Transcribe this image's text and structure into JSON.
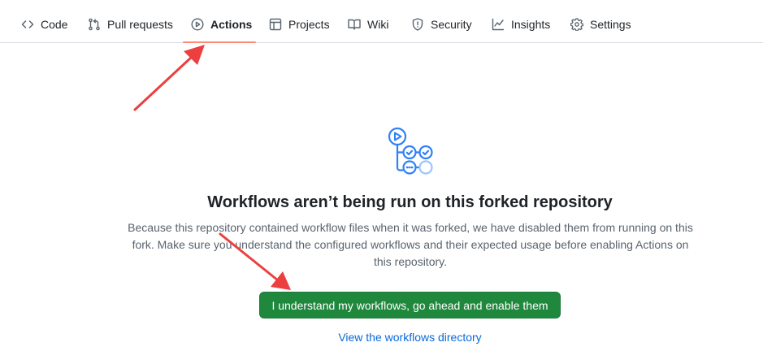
{
  "nav": {
    "items": [
      {
        "label": "Code",
        "icon": "code-icon"
      },
      {
        "label": "Pull requests",
        "icon": "git-pull-request-icon"
      },
      {
        "label": "Actions",
        "icon": "play-icon",
        "selected": true
      },
      {
        "label": "Projects",
        "icon": "table-icon"
      },
      {
        "label": "Wiki",
        "icon": "book-icon"
      },
      {
        "label": "Security",
        "icon": "shield-icon"
      },
      {
        "label": "Insights",
        "icon": "graph-icon"
      },
      {
        "label": "Settings",
        "icon": "gear-icon"
      }
    ],
    "selected_underline_color": "#fd8c73"
  },
  "blankslate": {
    "illustration": "workflow-graph-icon",
    "title": "Workflows aren’t being run on this forked repository",
    "description": "Because this repository contained workflow files when it was forked, we have disabled them from running on this fork. Make sure you understand the configured workflows and their expected usage before enabling Actions on this repository.",
    "enable_button_label": "I understand my workflows, go ahead and enable them",
    "directory_link_label": "View the workflows directory"
  },
  "colors": {
    "primary_button": "#1f883d",
    "link": "#0969da",
    "annotation_arrow": "#ec3f3f",
    "illustration": "#2f81f7"
  }
}
